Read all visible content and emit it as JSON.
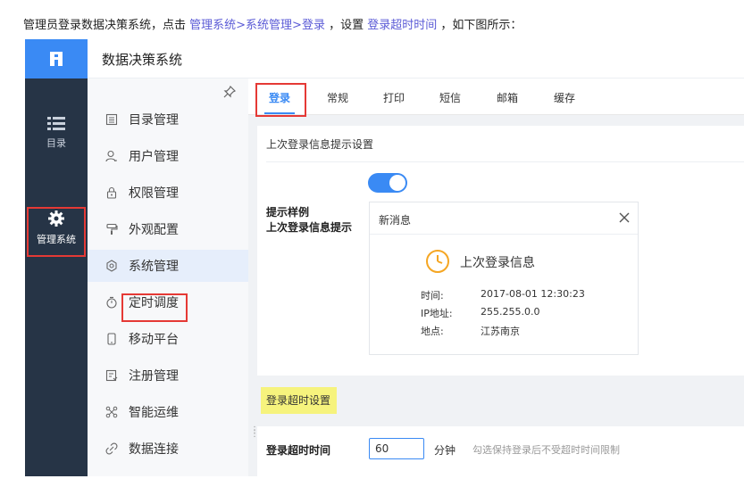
{
  "instruction": {
    "prefix": "管理员登录数据决策系统，点击",
    "path": "管理系统>系统管理>登录",
    "middle": "，设置",
    "setting": "登录超时时间",
    "suffix": "，如下图所示："
  },
  "app": {
    "title": "数据决策系统"
  },
  "rail": {
    "catalog_label": "目录",
    "manage_label": "管理系统"
  },
  "menu": {
    "items": [
      {
        "label": "目录管理",
        "icon": "catalog-list-icon"
      },
      {
        "label": "用户管理",
        "icon": "user-icon"
      },
      {
        "label": "权限管理",
        "icon": "lock-icon"
      },
      {
        "label": "外观配置",
        "icon": "paint-roller-icon"
      },
      {
        "label": "系统管理",
        "icon": "gear-icon"
      },
      {
        "label": "定时调度",
        "icon": "timer-icon"
      },
      {
        "label": "移动平台",
        "icon": "mobile-icon"
      },
      {
        "label": "注册管理",
        "icon": "register-icon"
      },
      {
        "label": "智能运维",
        "icon": "ops-icon"
      },
      {
        "label": "数据连接",
        "icon": "link-icon"
      }
    ],
    "active_index": 4
  },
  "tabs": [
    "登录",
    "常规",
    "打印",
    "短信",
    "邮箱",
    "缓存"
  ],
  "login_info": {
    "section_title": "上次登录信息提示设置",
    "toggle_label": "上次登录信息提示",
    "toggle_on": true,
    "sample_label": "提示样例"
  },
  "preview": {
    "header": "新消息",
    "title": "上次登录信息",
    "rows": [
      {
        "key": "时间:",
        "value": "2017-08-01 12:30:23"
      },
      {
        "key": "IP地址:",
        "value": "255.255.0.0"
      },
      {
        "key": "地点:",
        "value": "江苏南京"
      }
    ]
  },
  "timeout": {
    "section_title": "登录超时设置",
    "label": "登录超时时间",
    "value": "60",
    "unit": "分钟",
    "hint": "勾选保持登录后不受超时时间限制"
  },
  "colors": {
    "accent": "#3a8af4",
    "rail_bg": "#263446",
    "highlight_box": "#e53935",
    "yellow_highlight": "#f6f37d"
  }
}
